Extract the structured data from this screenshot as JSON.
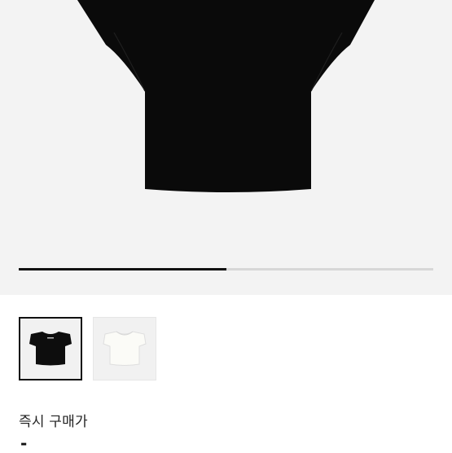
{
  "gallery": {
    "main_image": "black-tshirt-product-icon",
    "slide_progress_percent": 50,
    "colors": {
      "track": "#d7d7d7",
      "fill": "#111111",
      "background": "#f3f3f3"
    }
  },
  "thumbnails": [
    {
      "icon": "black-tshirt-icon",
      "selected": true,
      "color": "#111111"
    },
    {
      "icon": "white-tshirt-icon",
      "selected": false,
      "color": "#f4f4f0"
    }
  ],
  "purchase": {
    "label": "즉시 구매가",
    "price": "-"
  }
}
